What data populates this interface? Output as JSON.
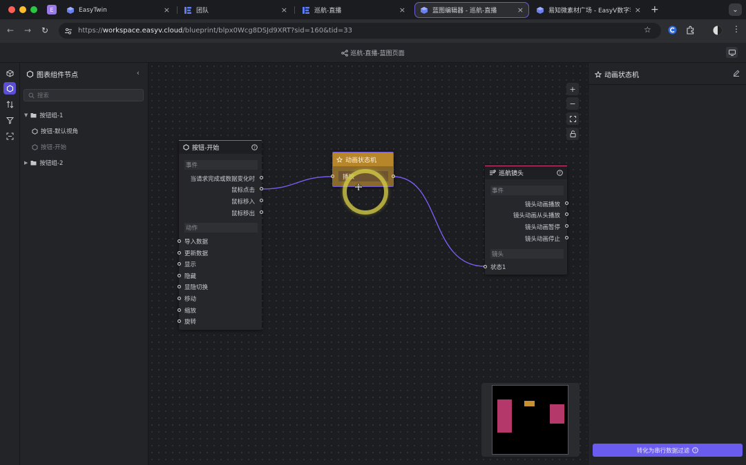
{
  "browser": {
    "tabs": [
      {
        "title": "EasyTwin",
        "favicon": "easytwin-logo",
        "active": false
      },
      {
        "title": "团队",
        "favicon": "easyv-logo",
        "active": false
      },
      {
        "title": "巡航-直播",
        "favicon": "easyv-logo",
        "active": false
      },
      {
        "title": "蓝图编辑器 - 巡航-直播",
        "favicon": "easytwin-logo",
        "active": true
      },
      {
        "title": "易知微素材广场 - EasyV数字孪",
        "favicon": "easytwin-logo",
        "active": false
      }
    ],
    "profile_letter": "E",
    "new_tab": "+",
    "url_prefix": "https://",
    "url_host": "workspace.easyv.cloud",
    "url_path": "/blueprint/blpx0Wcg8DSJd9XRT?sid=160&tid=33"
  },
  "app": {
    "breadcrumb": "巡航-直播-蓝图页面"
  },
  "left_panel": {
    "title": "图表组件节点",
    "search_placeholder": "搜索",
    "tree": [
      {
        "label": "按钮组-1",
        "type": "folder",
        "expanded": true
      },
      {
        "label": "按钮-默认视角",
        "type": "component"
      },
      {
        "label": "按钮-开始",
        "type": "component",
        "dim": true
      },
      {
        "label": "按钮组-2",
        "type": "folder",
        "expanded": false
      }
    ]
  },
  "canvas": {
    "nodes": {
      "button_start": {
        "title": "按钮-开始",
        "events_label": "事件",
        "events": [
          "当请求完成或数据变化时",
          "鼠标点击",
          "鼠标移入",
          "鼠标移出"
        ],
        "actions_label": "动作",
        "actions": [
          "导入数据",
          "更新数据",
          "显示",
          "隐藏",
          "显隐切换",
          "移动",
          "缩放",
          "旋转"
        ]
      },
      "state_machine": {
        "title": "动画状态机",
        "port": "播放",
        "color": "#b8862a"
      },
      "cruise_camera": {
        "title": "巡航镜头",
        "events_label": "事件",
        "events": [
          "镜头动画播放",
          "镜头动画从头播放",
          "镜头动画暂停",
          "镜头动画停止"
        ],
        "camera_label": "镜头",
        "camera_states": [
          "状态1"
        ]
      }
    },
    "zoom_controls": [
      "+",
      "−",
      "fit",
      "lock"
    ],
    "link_color": "#7b5cf2"
  },
  "right_panel": {
    "title": "动画状态机",
    "convert_button": "转化为串行数据过滤"
  }
}
